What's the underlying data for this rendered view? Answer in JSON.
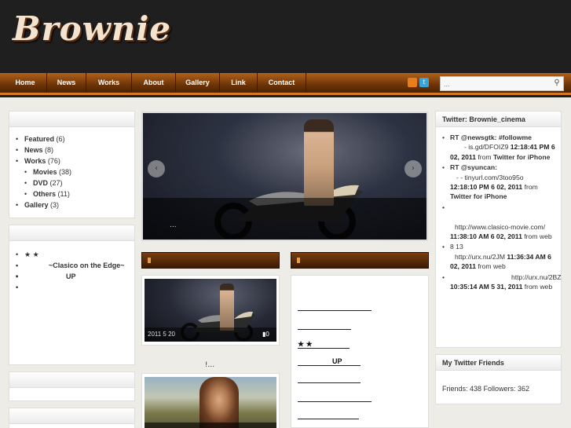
{
  "header": {
    "logo": "Brownie"
  },
  "nav": {
    "items": [
      "Home",
      "News",
      "Works",
      "About",
      "Gallery",
      "Link",
      "Contact"
    ]
  },
  "search": {
    "placeholder": "..."
  },
  "icons": {
    "rss": "rss-icon",
    "twitter": "twitter-icon",
    "search": "search-icon"
  },
  "colors": {
    "nav_top": "#b2611c",
    "nav_bottom": "#4a2202",
    "nav_border": "#d27a22",
    "logo": "#f4e4cf"
  },
  "categories": {
    "title": "",
    "items": [
      {
        "label": "Featured",
        "count": "(6)"
      },
      {
        "label": "News",
        "count": "(8)"
      },
      {
        "label": "Works",
        "count": "(76)"
      },
      {
        "label": "Movies",
        "count": "(38)"
      },
      {
        "label": "DVD",
        "count": "(27)"
      },
      {
        "label": "Others",
        "count": "(11)"
      },
      {
        "label": "Gallery",
        "count": "(3)"
      }
    ]
  },
  "recent_posts": {
    "title": "",
    "items": [
      "★ ★",
      "~Clasico on the Edge~",
      "",
      "",
      "",
      "",
      "",
      "UP",
      "",
      ""
    ]
  },
  "slider": {
    "caption": "...",
    "prev": "‹",
    "next": "›"
  },
  "post1": {
    "date": "2011 5 20",
    "comments": "0"
  },
  "post2": {
    "title": "!..."
  },
  "right_list": {
    "items": [
      "",
      "",
      "★ ★",
      "UP",
      "",
      "",
      ""
    ]
  },
  "twitter": {
    "title": "Twitter: Brownie_cinema",
    "tweets": [
      {
        "text": "RT @newsgtk: #followme",
        "detail": "- is.gd/DFOIZ9",
        "time": "12:18:41 PM 6 02, 2011",
        "via": "from",
        "client": "Twitter for iPhone"
      },
      {
        "text": "RT @syuncan:",
        "detail": "- - tinyurl.com/3too95o",
        "time": "12:18:10 PM 6 02, 2011",
        "via": "from",
        "client": "Twitter for iPhone"
      },
      {
        "text": "",
        "detail": "http://www.clasico-movie.com/",
        "time": "11:38:10 AM 6 02, 2011",
        "via": "from",
        "client": "web"
      },
      {
        "text": "8 13",
        "detail": "http://urx.nu/2JM",
        "time": "11:36:34 AM 6 02, 2011",
        "via": "from",
        "client": "web"
      },
      {
        "text": "",
        "detail": "http://urx.nu/2BZ",
        "time": "10:35:14 AM 5 31, 2011",
        "via": "from",
        "client": "web"
      }
    ]
  },
  "friends": {
    "title": "My Twitter Friends",
    "text": "Friends: 438 Followers: 362"
  }
}
